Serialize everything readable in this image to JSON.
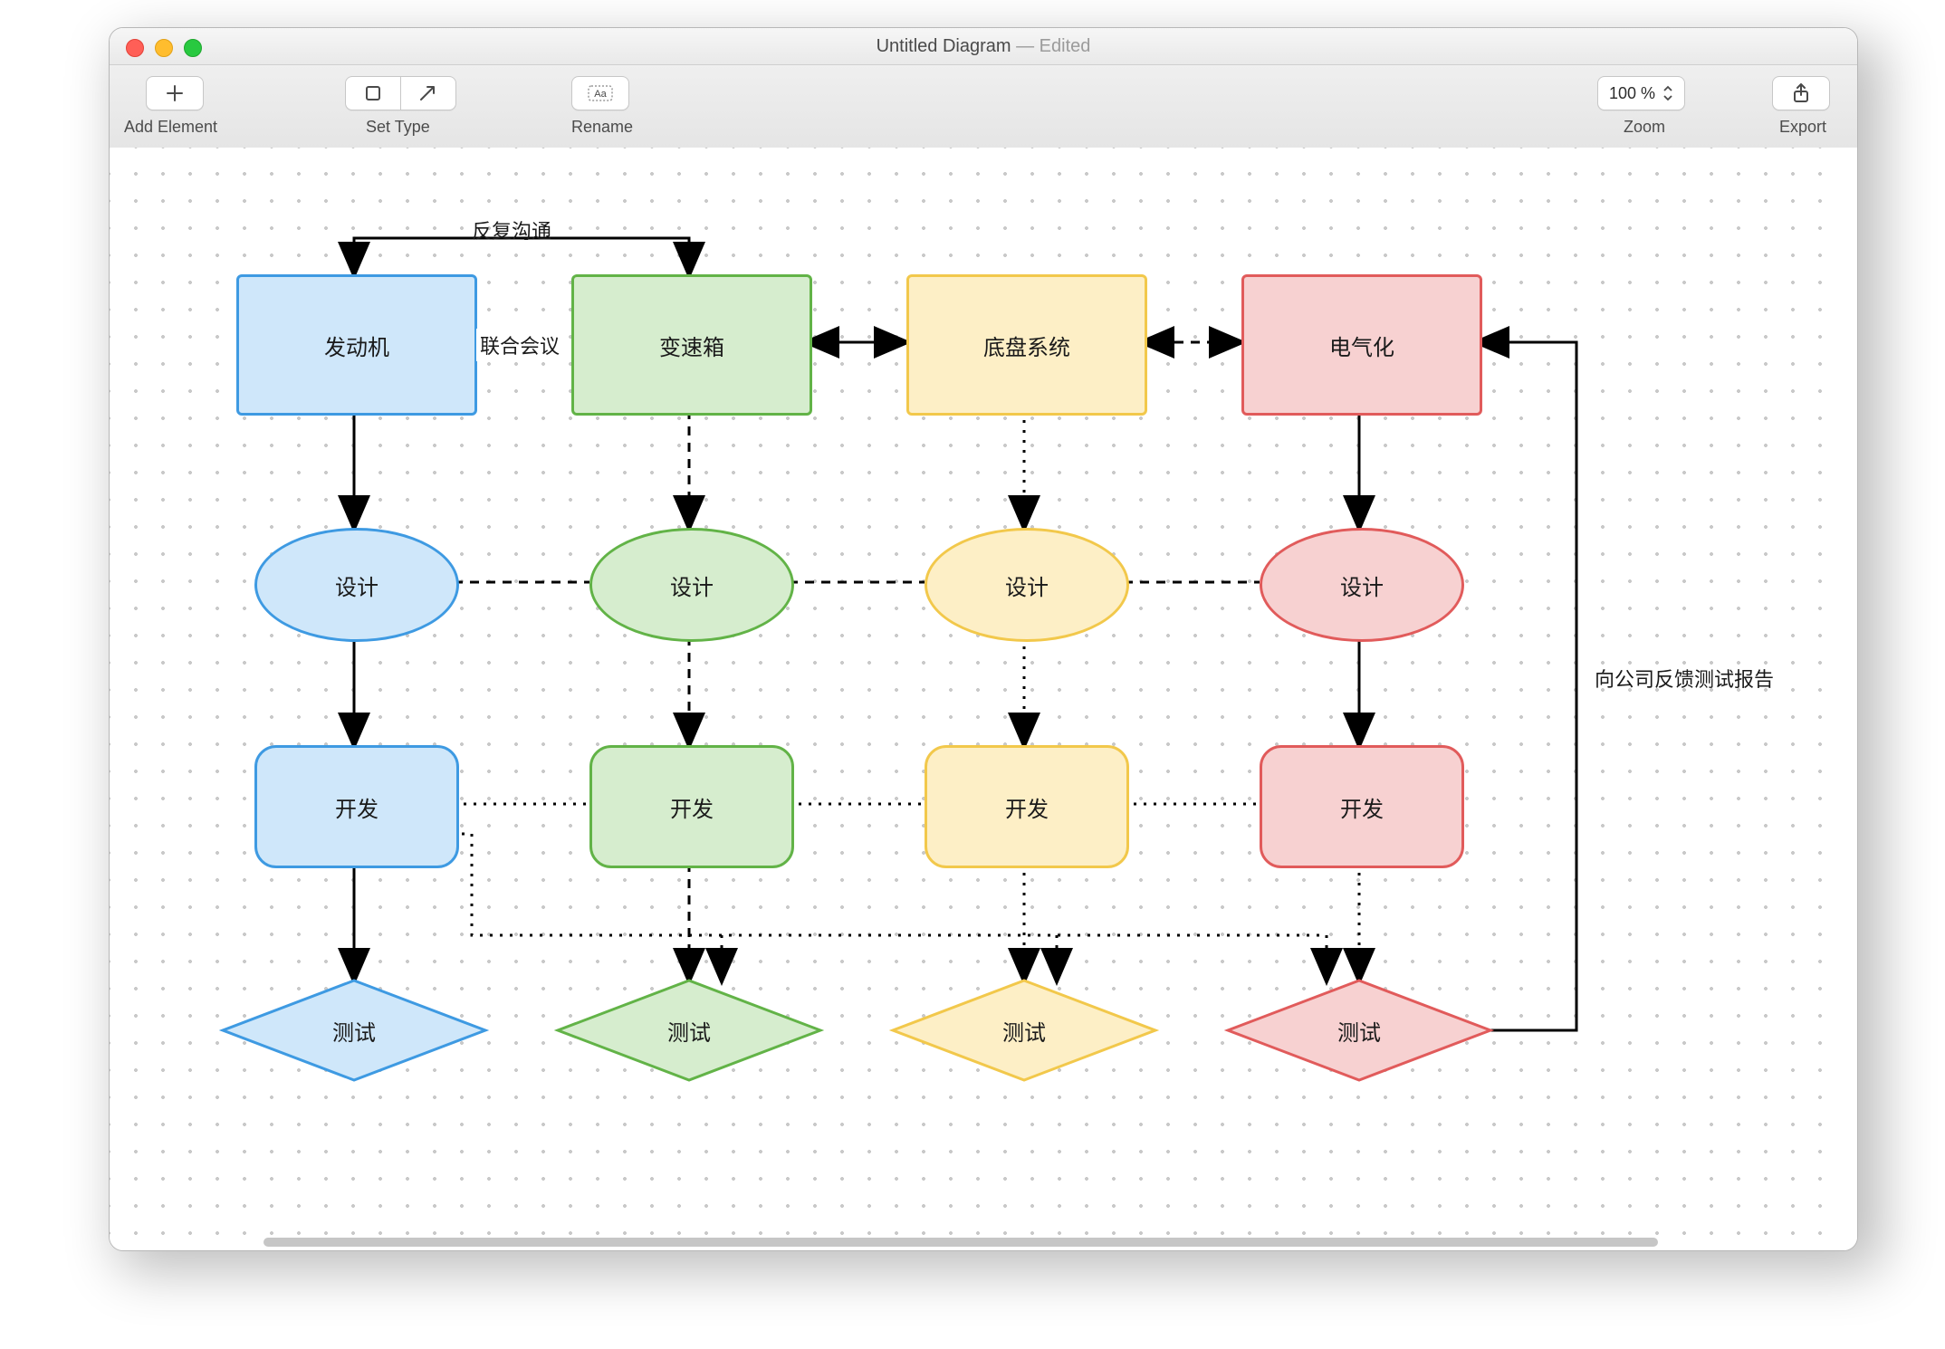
{
  "window": {
    "title": "Untitled Diagram",
    "edited_suffix": " — Edited"
  },
  "toolbar": {
    "add_element": "Add Element",
    "set_type": "Set Type",
    "rename": "Rename",
    "zoom": "Zoom",
    "zoom_value": "100 %",
    "export": "Export"
  },
  "colors": {
    "blue": {
      "fill": "#cfe7fa",
      "stroke": "#3e9ae2"
    },
    "green": {
      "fill": "#d6edce",
      "stroke": "#62b347"
    },
    "yellow": {
      "fill": "#fdefc6",
      "stroke": "#f2c84b"
    },
    "red": {
      "fill": "#f7d1d1",
      "stroke": "#e15b5b"
    }
  },
  "columns": [
    "blue",
    "green",
    "yellow",
    "red"
  ],
  "row_labels": {
    "top": [
      "发动机",
      "变速箱",
      "底盘系统",
      "电气化"
    ],
    "design": [
      "设计",
      "设计",
      "设计",
      "设计"
    ],
    "develop": [
      "开发",
      "开发",
      "开发",
      "开发"
    ],
    "test": [
      "测试",
      "测试",
      "测试",
      "测试"
    ]
  },
  "edge_labels": {
    "top_bidir": "反复沟通",
    "between_top_0_1": "联合会议",
    "feedback_right": "向公司反馈测试报告"
  },
  "edges": {
    "col_top_to_design": [
      {
        "style": "solid"
      },
      {
        "style": "dashed"
      },
      {
        "style": "dotted"
      },
      {
        "style": "solid"
      }
    ],
    "col_design_to_develop": [
      {
        "style": "solid"
      },
      {
        "style": "dashed"
      },
      {
        "style": "dotted"
      },
      {
        "style": "solid"
      }
    ],
    "col_develop_to_test": [
      {
        "style": "solid"
      },
      {
        "style": "dashed"
      },
      {
        "style": "dotted"
      },
      {
        "style": "dotted"
      }
    ],
    "row_top_between": [
      {
        "from": 0,
        "to": 1,
        "style": "solid",
        "bidir": true,
        "elevated": true,
        "label": "反复沟通"
      },
      {
        "from": 1,
        "to": 2,
        "style": "solid",
        "bidir": true
      },
      {
        "from": 2,
        "to": 3,
        "style": "dashed",
        "bidir": true
      }
    ],
    "row_design_between": [
      {
        "from": 0,
        "to": 1,
        "style": "dashed",
        "arrows": false
      },
      {
        "from": 1,
        "to": 2,
        "style": "dashed",
        "arrows": false
      },
      {
        "from": 2,
        "to": 3,
        "style": "dashed",
        "arrows": false
      }
    ],
    "row_develop_between": [
      {
        "from": 0,
        "to": 1,
        "style": "dotted",
        "arrows": false
      },
      {
        "from": 1,
        "to": 2,
        "style": "dotted",
        "arrows": false
      },
      {
        "from": 2,
        "to": 3,
        "style": "dotted",
        "arrows": false
      }
    ],
    "bus_develop_to_tests": {
      "style": "dotted",
      "from_col": 0,
      "to_cols": [
        1,
        2,
        3
      ]
    },
    "feedback_test_to_top": {
      "style": "solid",
      "from": "test.3",
      "to": "top.3"
    }
  }
}
